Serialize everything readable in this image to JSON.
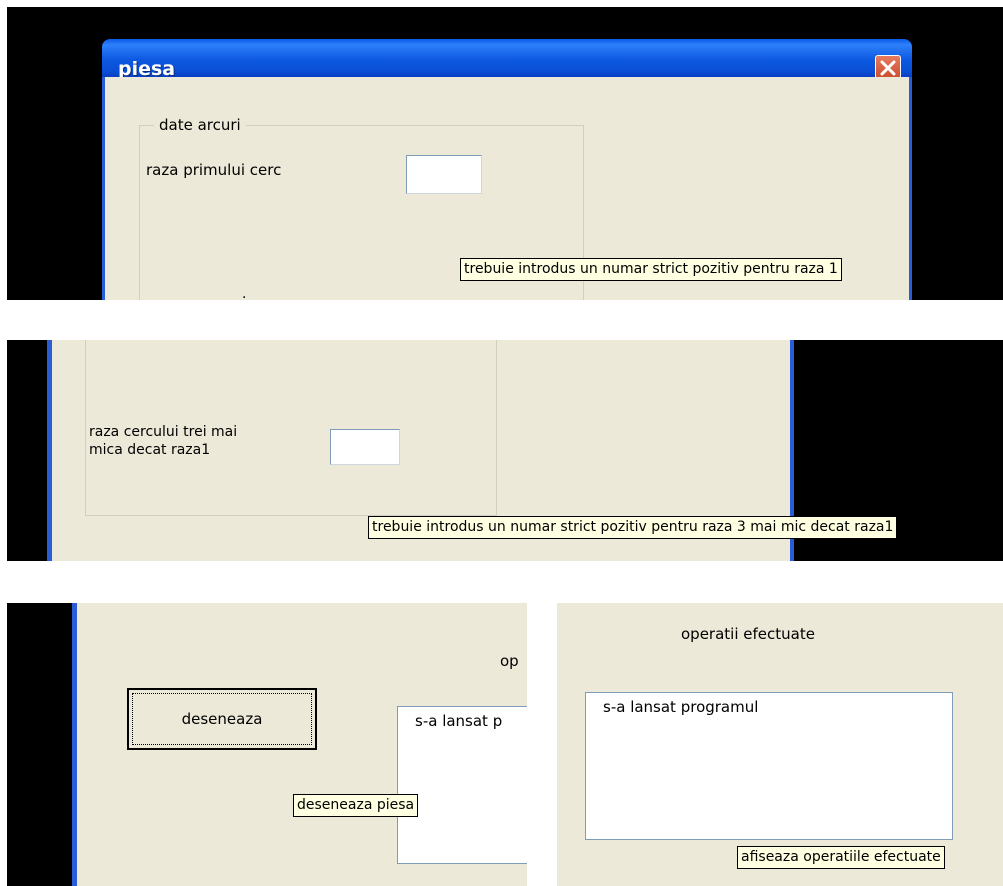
{
  "window": {
    "title": "piesa",
    "close_icon": "close-icon"
  },
  "panel1": {
    "groupbox_caption": "date arcuri",
    "radius1_label": "raza primului cerc",
    "radius1_value": "",
    "tooltip": "trebuie introdus un numar strict pozitiv pentru raza 1"
  },
  "panel2": {
    "radius3_label_line1": "raza cercului trei mai",
    "radius3_label_line2": "mica decat raza1",
    "radius3_value": "",
    "tooltip": "trebuie introdus un numar strict pozitiv pentru raza 3 mai mic decat raza1"
  },
  "panel3": {
    "draw_button": "deseneaza",
    "ops_label_partial": "op",
    "list_item_partial": "s-a lansat p",
    "tooltip": "deseneaza piesa"
  },
  "panel4": {
    "ops_label": "operatii efectuate",
    "list_items": [
      "s-a lansat programul"
    ],
    "tooltip": "afiseaza operatiile efectuate"
  }
}
